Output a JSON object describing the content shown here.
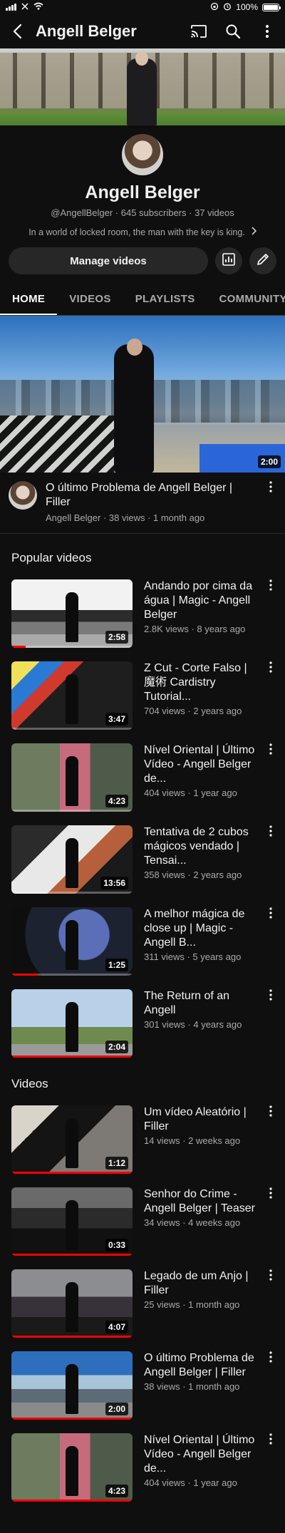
{
  "status_bar": {
    "battery": "100%"
  },
  "header": {
    "title": "Angell Belger"
  },
  "channel": {
    "name": "Angell Belger",
    "meta": "@AngellBelger · 645 subscribers · 37 videos",
    "description": "In a world of locked room, the man with the key is king."
  },
  "actions": {
    "manage_label": "Manage videos"
  },
  "tabs": [
    {
      "label": "HOME"
    },
    {
      "label": "VIDEOS"
    },
    {
      "label": "PLAYLISTS"
    },
    {
      "label": "COMMUNITY"
    }
  ],
  "featured": {
    "title": "O último Problema de Angell Belger | Filler",
    "meta": "Angell Belger · 38 views · 1 month ago",
    "duration": "2:00"
  },
  "popular": {
    "section_title": "Popular videos",
    "items": [
      {
        "title": "Andando por cima da água | Magic - Angell Belger",
        "meta": "2.8K views · 8 years ago",
        "duration": "2:58",
        "progress": 0.12
      },
      {
        "title": "Z Cut - Corte Falso | 魔術 Cardistry Tutorial...",
        "meta": "704 views · 2 years ago",
        "duration": "3:47",
        "progress": 0
      },
      {
        "title": "Nível Oriental | Último Vídeo - Angell Belger de...",
        "meta": "404 views · 1 year ago",
        "duration": "4:23",
        "progress": 0
      },
      {
        "title": "Tentativa de 2 cubos mágicos vendado | Tensai...",
        "meta": "358 views · 2 years ago",
        "duration": "13:56",
        "progress": 0
      },
      {
        "title": "A melhor mágica de close up | Magic - Angell B...",
        "meta": "311 views · 5 years ago",
        "duration": "1:25",
        "progress": 0.22
      },
      {
        "title": "The Return of an Angell",
        "meta": "301 views · 4 years ago",
        "duration": "2:04",
        "progress": 1
      }
    ]
  },
  "videos": {
    "section_title": "Videos",
    "items": [
      {
        "title": "Um vídeo Aleatório | Filler",
        "meta": "14 views · 2 weeks ago",
        "duration": "1:12",
        "progress": 1
      },
      {
        "title": "Senhor do Crime - Angell Belger | Teaser",
        "meta": "34 views · 4 weeks ago",
        "duration": "0:33",
        "progress": 1
      },
      {
        "title": "Legado de um Anjo | Filler",
        "meta": "25 views · 1 month ago",
        "duration": "4:07",
        "progress": 1
      },
      {
        "title": "O último Problema de Angell Belger | Filler",
        "meta": "38 views · 1 month ago",
        "duration": "2:00",
        "progress": 1
      },
      {
        "title": "Nível Oriental | Último Vídeo - Angell Belger de...",
        "meta": "404 views · 1 year ago",
        "duration": "4:23",
        "progress": 1
      }
    ]
  },
  "icons": {
    "back": "back-arrow-icon",
    "cast": "cast-icon",
    "search": "search-icon",
    "more": "more-vertical-icon",
    "analytics": "analytics-icon",
    "edit": "pencil-icon",
    "chevron": "chevron-right-icon"
  },
  "colors": {
    "background": "#0f0f0f",
    "accent": "#ff0000",
    "button": "#272727"
  }
}
